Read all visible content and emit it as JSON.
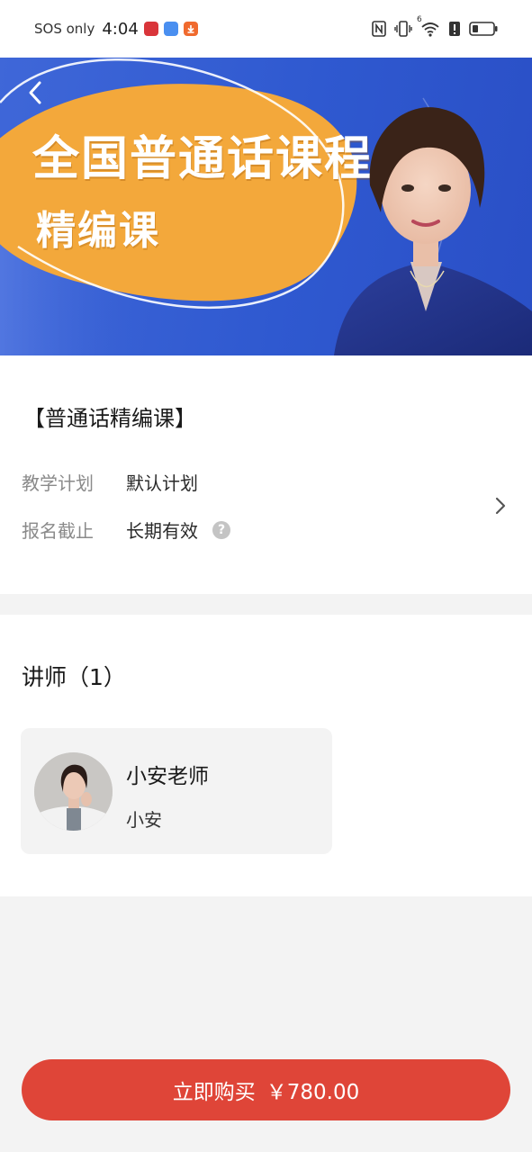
{
  "status_bar": {
    "carrier": "SOS only",
    "time": "4:04",
    "signal_badge": "6",
    "app_icons": [
      {
        "name": "news-app-icon",
        "color": "#d9353a"
      },
      {
        "name": "browser-app-icon",
        "color": "#4a8ff0"
      },
      {
        "name": "download-app-icon",
        "color": "#f06a2e"
      }
    ]
  },
  "banner": {
    "title": "全国普通话课程",
    "subtitle": "精编课",
    "colors": {
      "background": "#3461d4",
      "blob": "#f3a83b"
    }
  },
  "course": {
    "name": "【普通话精编课】",
    "plan_label": "教学计划",
    "plan_value": "默认计划",
    "deadline_label": "报名截止",
    "deadline_value": "长期有效",
    "help_glyph": "?"
  },
  "teachers": {
    "title": "讲师（1）",
    "items": [
      {
        "name": "小安老师",
        "subtitle": "小安"
      }
    ]
  },
  "buy": {
    "label": "立即购买",
    "price": "￥780.00",
    "color": "#df4538"
  }
}
